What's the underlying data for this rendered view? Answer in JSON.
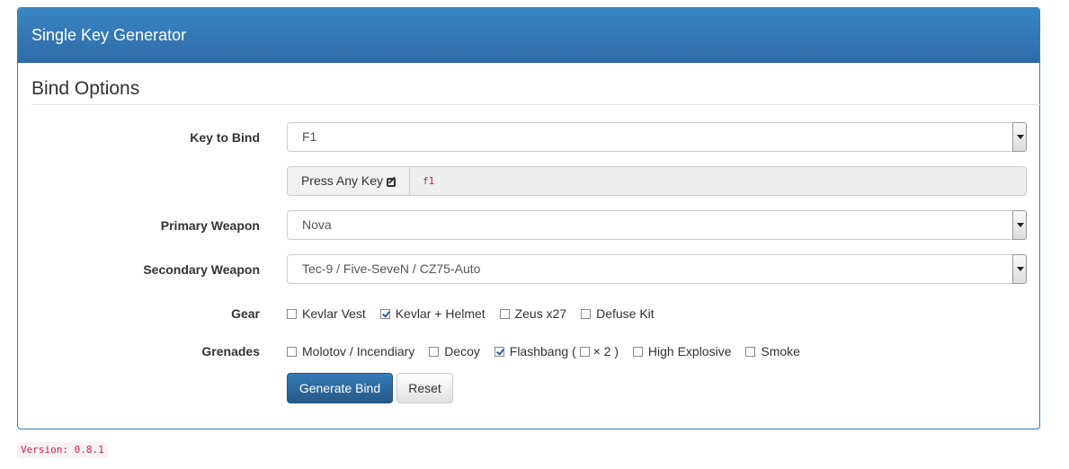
{
  "panel": {
    "title": "Single Key Generator"
  },
  "form": {
    "legend": "Bind Options",
    "key_label": "Key to Bind",
    "key_value": "F1",
    "press_key_button": "Press Any Key",
    "pressed_key_code": "f1",
    "primary_label": "Primary Weapon",
    "primary_value": "Nova",
    "secondary_label": "Secondary Weapon",
    "secondary_value": "Tec-9 / Five-SeveN / CZ75-Auto",
    "gear_label": "Gear",
    "gear": [
      {
        "label": "Kevlar Vest",
        "checked": false
      },
      {
        "label": "Kevlar + Helmet",
        "checked": true
      },
      {
        "label": "Zeus x27",
        "checked": false
      },
      {
        "label": "Defuse Kit",
        "checked": false
      }
    ],
    "grenades_label": "Grenades",
    "grenades": {
      "molotov": {
        "label": "Molotov / Incendiary",
        "checked": false
      },
      "decoy": {
        "label": "Decoy",
        "checked": false
      },
      "flashbang": {
        "label": "Flashbang (",
        "checked": true
      },
      "flashbang_x2": {
        "label": "× 2 )",
        "checked": false
      },
      "he": {
        "label": "High Explosive",
        "checked": false
      },
      "smoke": {
        "label": "Smoke",
        "checked": false
      }
    },
    "generate_button": "Generate Bind",
    "reset_button": "Reset"
  },
  "footer": {
    "version": "Version: 0.8.1"
  }
}
